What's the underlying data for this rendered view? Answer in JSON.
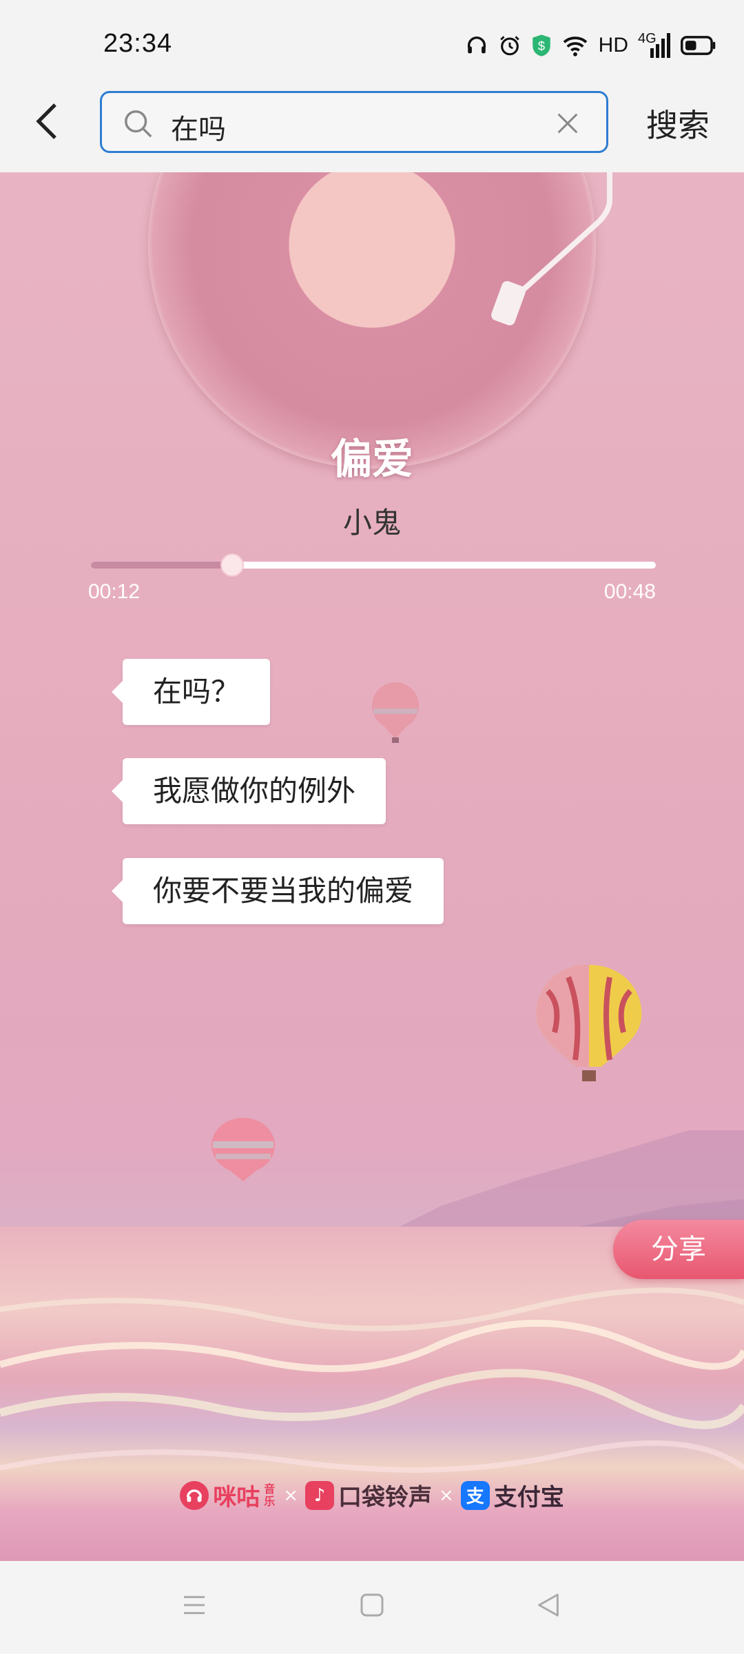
{
  "status_bar": {
    "time": "23:34",
    "hd_label": "HD",
    "network_label": "4G",
    "icons": [
      "headphones-icon",
      "alarm-icon",
      "shield-icon",
      "wifi-icon",
      "signal-icon",
      "battery-icon"
    ]
  },
  "search": {
    "query": "在吗",
    "submit_label": "搜索",
    "accent_color": "#2d7dd2"
  },
  "player": {
    "title": "偏爱",
    "artist": "小鬼",
    "current_time": "00:12",
    "total_time": "00:48",
    "progress": 0.25
  },
  "lyrics": [
    "在吗？",
    "我愿做你的例外",
    "你要不要当我的偏爱"
  ],
  "share_label": "分享",
  "brands": [
    {
      "name": "咪咕音乐",
      "text": "咪咕",
      "sub": "音乐",
      "color": "#e8405f"
    },
    {
      "name": "口袋铃声",
      "text": "口袋铃声",
      "color": "#e8405f"
    },
    {
      "name": "支付宝",
      "text": "支付宝",
      "color": "#1677ff"
    }
  ],
  "brand_separator": "×",
  "nav": [
    "menu-icon",
    "home-icon",
    "back-icon"
  ]
}
